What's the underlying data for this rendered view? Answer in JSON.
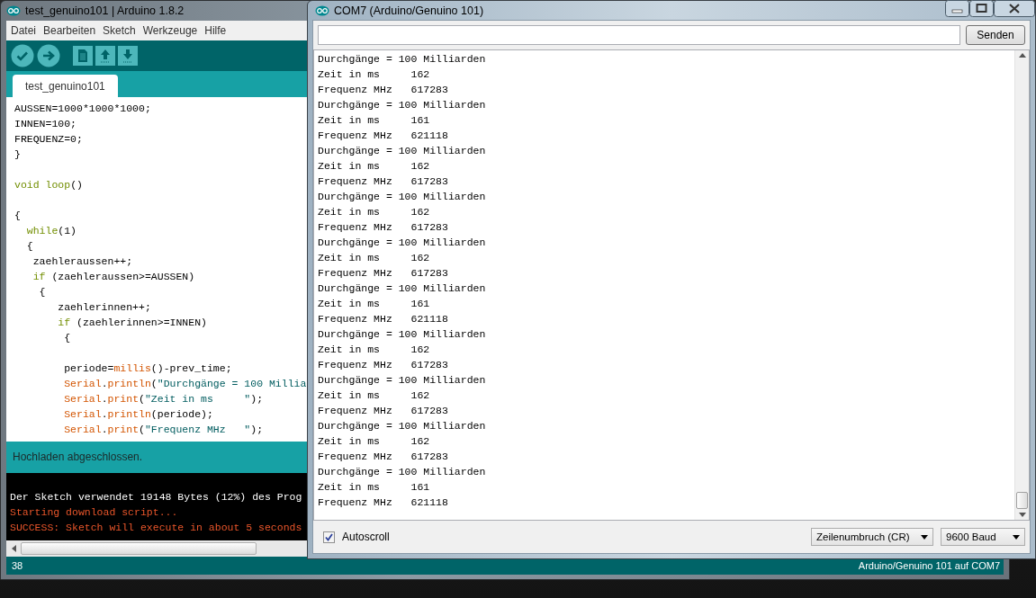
{
  "ide": {
    "title": "test_genuino101 | Arduino 1.8.2",
    "menu": [
      "Datei",
      "Bearbeiten",
      "Sketch",
      "Werkzeuge",
      "Hilfe"
    ],
    "tabs": [
      {
        "label": "test_genuino101",
        "selected": true
      }
    ],
    "code_lines": [
      {
        "kind": "code",
        "segments": [
          {
            "kind": "plain",
            "text": "AUSSEN=1000*1000*1000;"
          }
        ]
      },
      {
        "kind": "code",
        "segments": [
          {
            "kind": "plain",
            "text": "INNEN=100;"
          }
        ]
      },
      {
        "kind": "code",
        "segments": [
          {
            "kind": "plain",
            "text": "FREQUENZ=0;"
          }
        ]
      },
      {
        "kind": "code",
        "segments": [
          {
            "kind": "plain",
            "text": "}"
          }
        ]
      },
      {
        "kind": "blank"
      },
      {
        "kind": "code",
        "segments": [
          {
            "kind": "keyword",
            "text": "void loop"
          },
          {
            "kind": "plain",
            "text": "()"
          }
        ]
      },
      {
        "kind": "blank"
      },
      {
        "kind": "code",
        "segments": [
          {
            "kind": "plain",
            "text": "{"
          }
        ]
      },
      {
        "kind": "code",
        "segments": [
          {
            "kind": "keyword",
            "text": "  while"
          },
          {
            "kind": "plain",
            "text": "(1)"
          }
        ]
      },
      {
        "kind": "code",
        "segments": [
          {
            "kind": "plain",
            "text": "  {"
          }
        ]
      },
      {
        "kind": "code",
        "segments": [
          {
            "kind": "plain",
            "text": "   zaehleraussen++;"
          }
        ]
      },
      {
        "kind": "code",
        "segments": [
          {
            "kind": "keyword",
            "text": "   if"
          },
          {
            "kind": "plain",
            "text": " (zaehleraussen>=AUSSEN)"
          }
        ]
      },
      {
        "kind": "code",
        "segments": [
          {
            "kind": "plain",
            "text": "    {"
          }
        ]
      },
      {
        "kind": "code",
        "segments": [
          {
            "kind": "plain",
            "text": "       zaehlerinnen++;"
          }
        ]
      },
      {
        "kind": "code",
        "segments": [
          {
            "kind": "keyword",
            "text": "       if"
          },
          {
            "kind": "plain",
            "text": " (zaehlerinnen>=INNEN)"
          }
        ]
      },
      {
        "kind": "code",
        "segments": [
          {
            "kind": "plain",
            "text": "        {"
          }
        ]
      },
      {
        "kind": "blank"
      },
      {
        "kind": "code",
        "segments": [
          {
            "kind": "plain",
            "text": "        periode="
          },
          {
            "kind": "function",
            "text": "millis"
          },
          {
            "kind": "plain",
            "text": "()-prev_time;"
          }
        ]
      },
      {
        "kind": "code",
        "segments": [
          {
            "kind": "function",
            "text": "        Serial"
          },
          {
            "kind": "plain",
            "text": "."
          },
          {
            "kind": "function",
            "text": "println"
          },
          {
            "kind": "plain",
            "text": "("
          },
          {
            "kind": "string",
            "text": "\"Durchgänge = 100 Millia"
          }
        ]
      },
      {
        "kind": "code",
        "segments": [
          {
            "kind": "function",
            "text": "        Serial"
          },
          {
            "kind": "plain",
            "text": "."
          },
          {
            "kind": "function",
            "text": "print"
          },
          {
            "kind": "plain",
            "text": "("
          },
          {
            "kind": "string",
            "text": "\"Zeit in ms     \""
          },
          {
            "kind": "plain",
            "text": ");"
          }
        ]
      },
      {
        "kind": "code",
        "segments": [
          {
            "kind": "function",
            "text": "        Serial"
          },
          {
            "kind": "plain",
            "text": "."
          },
          {
            "kind": "function",
            "text": "println"
          },
          {
            "kind": "plain",
            "text": "(periode);"
          }
        ]
      },
      {
        "kind": "code",
        "segments": [
          {
            "kind": "function",
            "text": "        Serial"
          },
          {
            "kind": "plain",
            "text": "."
          },
          {
            "kind": "function",
            "text": "print"
          },
          {
            "kind": "plain",
            "text": "("
          },
          {
            "kind": "string",
            "text": "\"Frequenz MHz   \""
          },
          {
            "kind": "plain",
            "text": ");"
          }
        ]
      }
    ],
    "status_message": "Hochladen abgeschlossen.",
    "console_lines": [
      {
        "kind": "info",
        "text": "Der Sketch verwendet 19148 Bytes (12%) des Prog"
      },
      {
        "kind": "error",
        "text": "Starting download script..."
      },
      {
        "kind": "error",
        "text": "SUCCESS: Sketch will execute in about 5 seconds"
      }
    ],
    "line_number": "38",
    "board": "Arduino/Genuino 101 auf COM7"
  },
  "serial_monitor": {
    "title": "COM7 (Arduino/Genuino 101)",
    "send_button": "Senden",
    "output_lines": [
      "Durchgänge = 100 Milliarden",
      "Zeit in ms     162",
      "Frequenz MHz   617283",
      "Durchgänge = 100 Milliarden",
      "Zeit in ms     161",
      "Frequenz MHz   621118",
      "Durchgänge = 100 Milliarden",
      "Zeit in ms     162",
      "Frequenz MHz   617283",
      "Durchgänge = 100 Milliarden",
      "Zeit in ms     162",
      "Frequenz MHz   617283",
      "Durchgänge = 100 Milliarden",
      "Zeit in ms     162",
      "Frequenz MHz   617283",
      "Durchgänge = 100 Milliarden",
      "Zeit in ms     161",
      "Frequenz MHz   621118",
      "Durchgänge = 100 Milliarden",
      "Zeit in ms     162",
      "Frequenz MHz   617283",
      "Durchgänge = 100 Milliarden",
      "Zeit in ms     162",
      "Frequenz MHz   617283",
      "Durchgänge = 100 Milliarden",
      "Zeit in ms     162",
      "Frequenz MHz   617283",
      "Durchgänge = 100 Milliarden",
      "Zeit in ms     161",
      "Frequenz MHz   621118"
    ],
    "autoscroll": {
      "label": "Autoscroll",
      "checked": true
    },
    "line_ending": "Zeilenumbruch (CR)",
    "baud_rate": "9600 Baud"
  }
}
